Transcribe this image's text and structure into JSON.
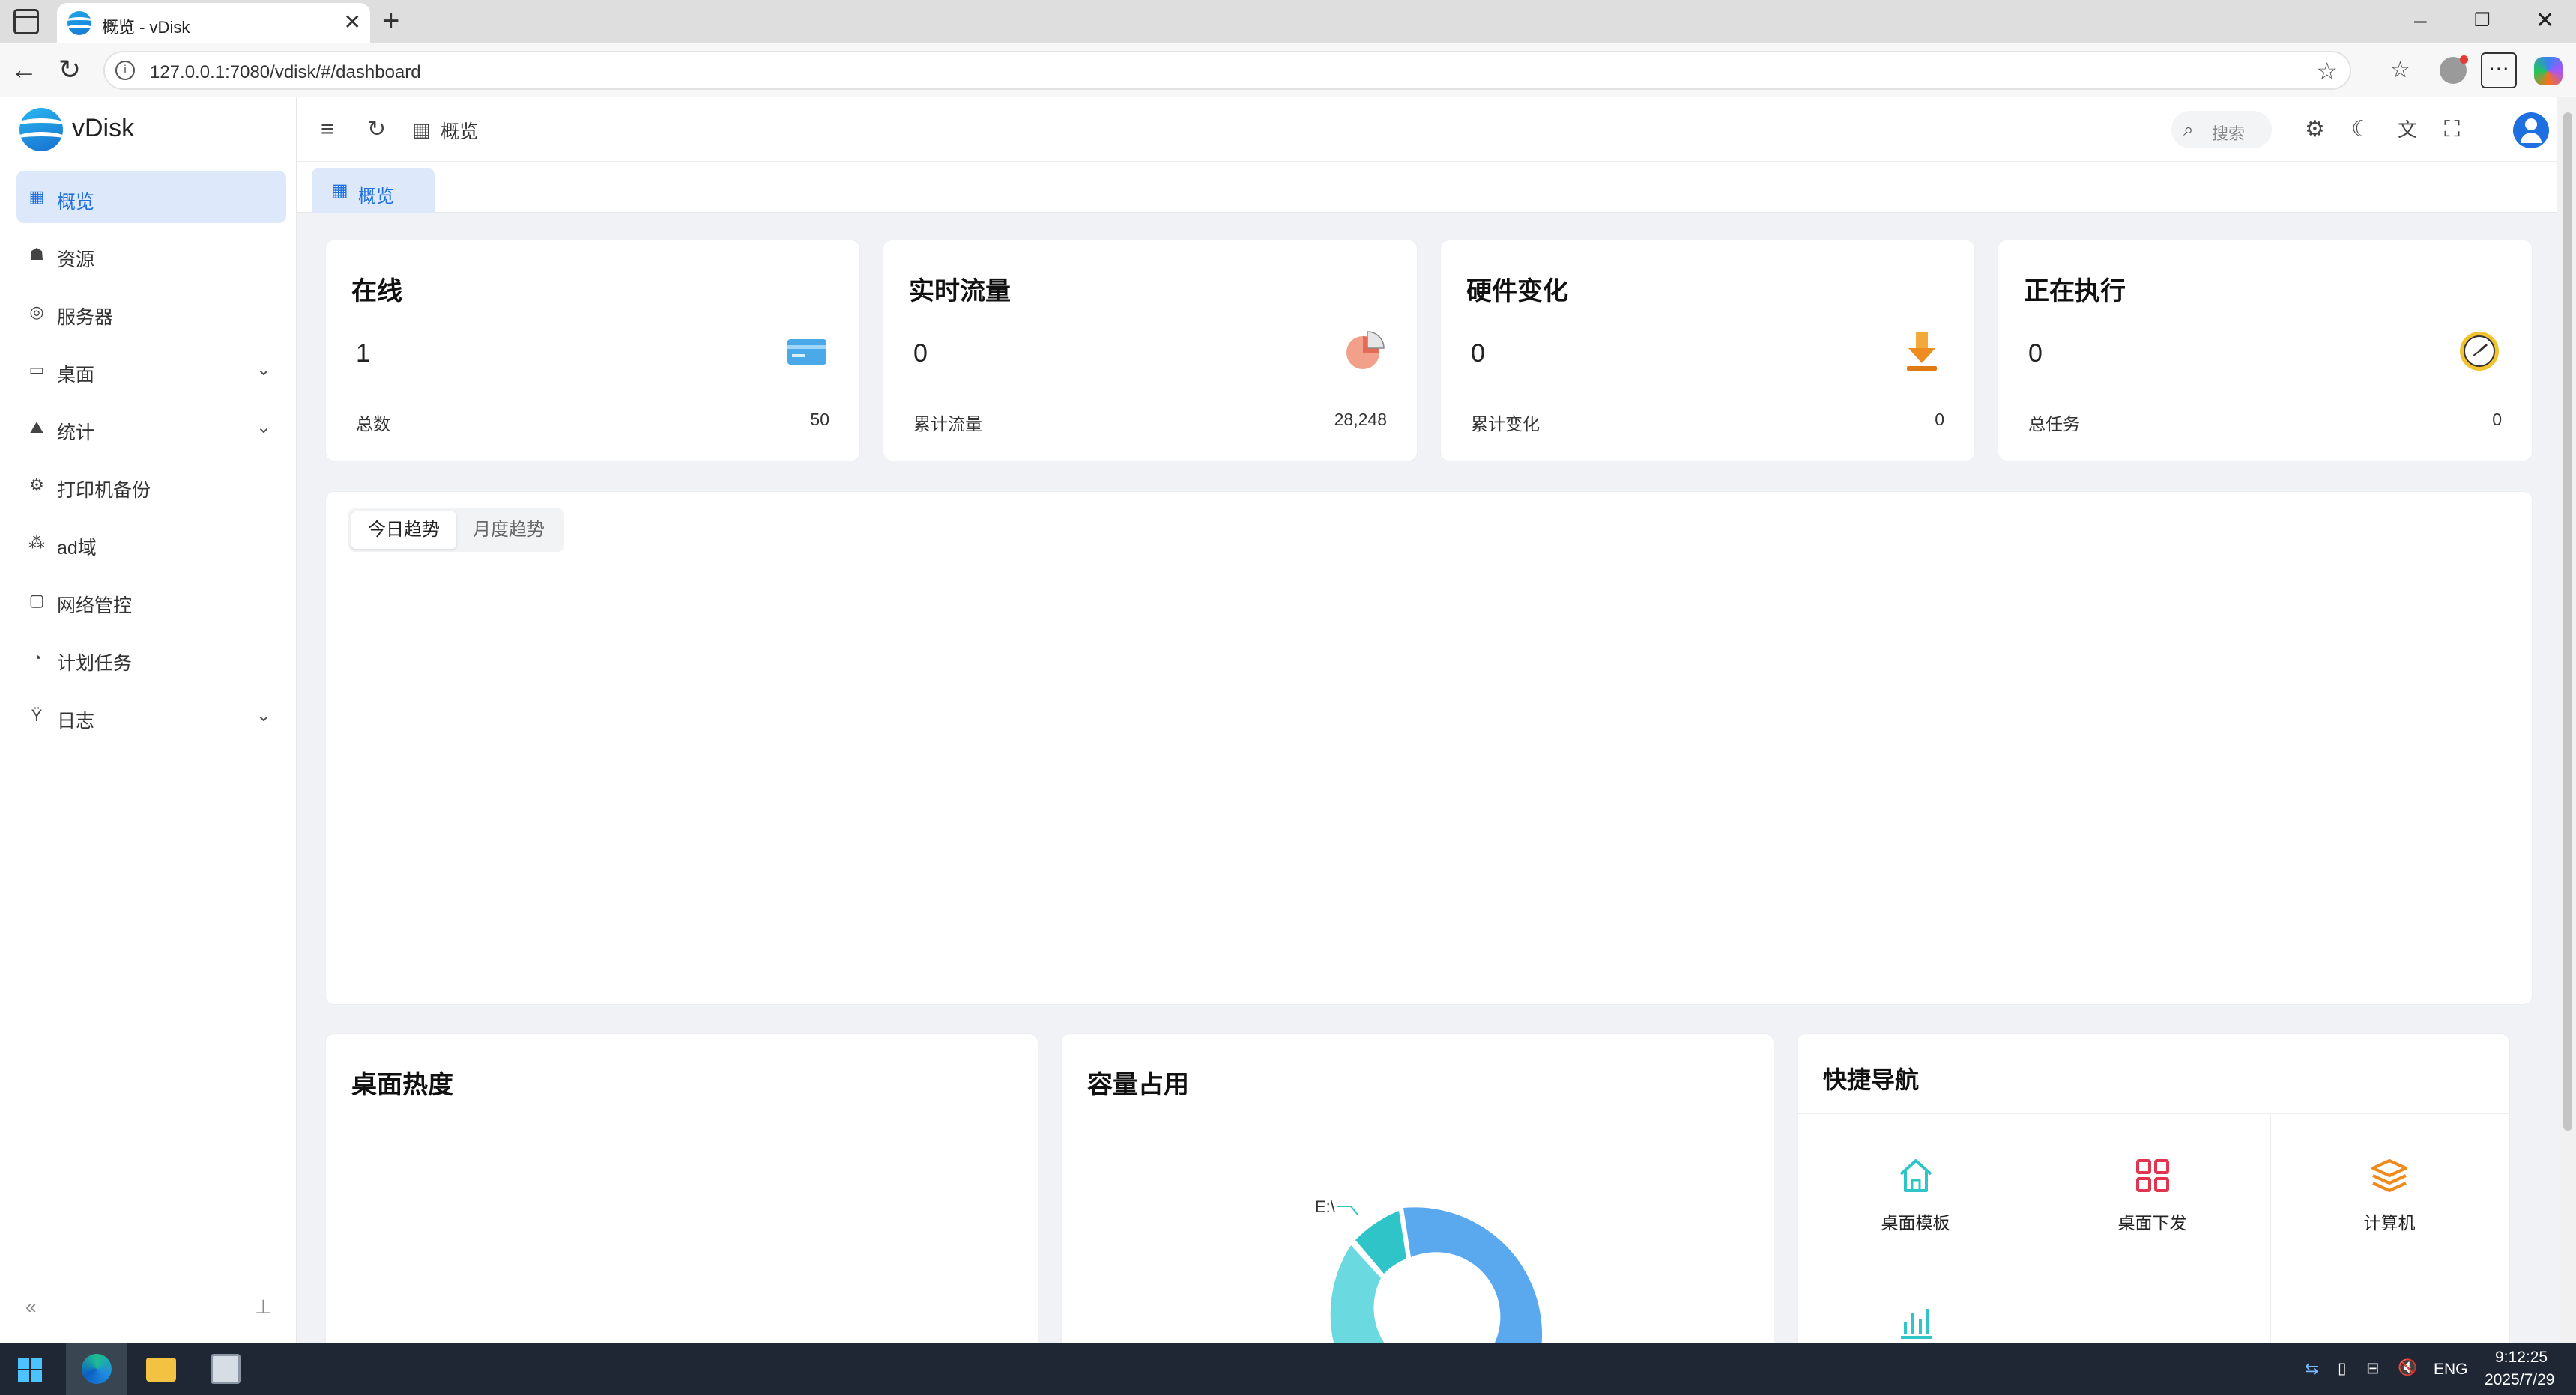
{
  "browser": {
    "tab_title": "概览 - vDisk",
    "url": "127.0.0.1:7080/vdisk/#/dashboard",
    "controls": {
      "minimize": "–",
      "restore": "❐",
      "close": "✕"
    }
  },
  "app": {
    "name": "vDisk"
  },
  "sidebar": {
    "items": [
      {
        "label": "概览",
        "icon": "dashboard-grid-icon"
      },
      {
        "label": "资源",
        "icon": "resource-icon"
      },
      {
        "label": "服务器",
        "icon": "server-icon"
      },
      {
        "label": "桌面",
        "icon": "desktop-icon"
      },
      {
        "label": "统计",
        "icon": "stats-icon"
      },
      {
        "label": "打印机备份",
        "icon": "printer-icon"
      },
      {
        "label": "ad域",
        "icon": "ad-domain-icon"
      },
      {
        "label": "网络管控",
        "icon": "network-icon"
      },
      {
        "label": "计划任务",
        "icon": "schedule-icon"
      },
      {
        "label": "日志",
        "icon": "log-icon"
      }
    ]
  },
  "header": {
    "breadcrumb": "概览",
    "search_placeholder": "搜索"
  },
  "page_tab": {
    "label": "概览"
  },
  "stats": [
    {
      "title": "在线",
      "value": "1",
      "sub_label": "总数",
      "sub_value": "50",
      "icon": "id-card-icon"
    },
    {
      "title": "实时流量",
      "value": "0",
      "sub_label": "累计流量",
      "sub_value": "28,248",
      "icon": "pie-chart-icon"
    },
    {
      "title": "硬件变化",
      "value": "0",
      "sub_label": "累计变化",
      "sub_value": "0",
      "icon": "download-arrow-icon"
    },
    {
      "title": "正在执行",
      "value": "0",
      "sub_label": "总任务",
      "sub_value": "0",
      "icon": "clock-icon"
    }
  ],
  "trend": {
    "tabs": [
      "今日趋势",
      "月度趋势"
    ],
    "selected": "今日趋势"
  },
  "desktop_heat": {
    "title": "桌面热度"
  },
  "capacity": {
    "title": "容量占用",
    "chart_data": {
      "type": "pie",
      "labels": [
        "E:\\"
      ],
      "colors": [
        "#2ec4c8",
        "#5aa9ee",
        "#6ad9e0"
      ]
    }
  },
  "quick_nav": {
    "title": "快捷导航",
    "items": [
      {
        "label": "桌面模板",
        "icon": "home-icon",
        "color": "#2ec4c8"
      },
      {
        "label": "桌面下发",
        "icon": "grid-icon",
        "color": "#e0344f"
      },
      {
        "label": "计算机",
        "icon": "layers-icon",
        "color": "#f08a1a"
      }
    ]
  },
  "taskbar": {
    "lang": "ENG",
    "time": "9:12:25",
    "date": "2025/7/29"
  }
}
